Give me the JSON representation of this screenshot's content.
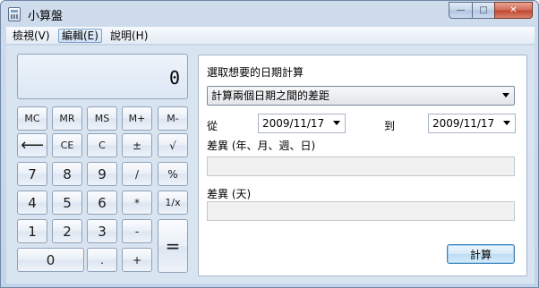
{
  "window": {
    "title": "小算盤",
    "controls": {
      "minimize": "—",
      "maximize": "□",
      "close": "✕"
    }
  },
  "menu": [
    "檢視(V)",
    "編輯(E)",
    "說明(H)"
  ],
  "calculator": {
    "display": "0",
    "rows": [
      [
        "MC",
        "MR",
        "MS",
        "M+",
        "M-"
      ],
      [
        "⟵",
        "CE",
        "C",
        "±",
        "√"
      ],
      [
        "7",
        "8",
        "9",
        "/",
        "%"
      ],
      [
        "4",
        "5",
        "6",
        "*",
        "1/x"
      ],
      [
        "1",
        "2",
        "3",
        "-",
        "="
      ],
      [
        "0",
        ".",
        "+"
      ]
    ]
  },
  "date_calc": {
    "heading": "選取想要的日期計算",
    "mode_selected": "計算兩個日期之間的差距",
    "from_label": "從",
    "from_date": "2009/11/17",
    "to_label": "到",
    "to_date": "2009/11/17",
    "diff_label": "差異 (年、月、週、日)",
    "diff_value": "",
    "diff_days_label": "差異 (天)",
    "diff_days_value": "",
    "calculate_button": "計算"
  }
}
